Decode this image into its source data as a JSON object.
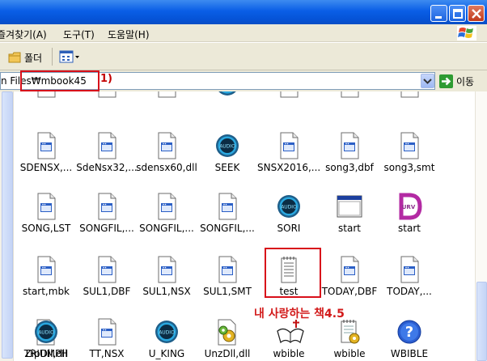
{
  "menu": {
    "items": [
      {
        "label": "즐겨찾기(A)"
      },
      {
        "label": "도구(T)"
      },
      {
        "label": "도움말(H)"
      }
    ]
  },
  "toolbar": {
    "folders_label": "폴더"
  },
  "address": {
    "path": "n Files₩mbook45",
    "go_label": "이동",
    "annotation": "1)"
  },
  "files": [
    {
      "name": "SDENSX,...",
      "icon": "generic-file-icon"
    },
    {
      "name": "SdeNsx32,...",
      "icon": "generic-file-icon"
    },
    {
      "name": "sdensx60,dll",
      "icon": "generic-file-icon"
    },
    {
      "name": "SEEK",
      "icon": "audio-icon"
    },
    {
      "name": "SNSX2016,...",
      "icon": "generic-file-icon"
    },
    {
      "name": "song3,dbf",
      "icon": "generic-file-icon"
    },
    {
      "name": "song3,smt",
      "icon": "generic-file-icon"
    },
    {
      "name": "SONG,LST",
      "icon": "generic-file-icon"
    },
    {
      "name": "SONGFIL,...",
      "icon": "generic-file-icon"
    },
    {
      "name": "SONGFIL,...",
      "icon": "generic-file-icon"
    },
    {
      "name": "SONGFIL,...",
      "icon": "generic-file-icon"
    },
    {
      "name": "SORI",
      "icon": "audio-icon"
    },
    {
      "name": "start",
      "icon": "window-icon"
    },
    {
      "name": "start",
      "icon": "urv-icon"
    },
    {
      "name": "start,mbk",
      "icon": "generic-file-icon"
    },
    {
      "name": "SUL1,DBF",
      "icon": "generic-file-icon"
    },
    {
      "name": "SUL1,NSX",
      "icon": "generic-file-icon"
    },
    {
      "name": "SUL1,SMT",
      "icon": "generic-file-icon"
    },
    {
      "name": "test",
      "icon": "text-file-icon"
    },
    {
      "name": "TODAY,DBF",
      "icon": "generic-file-icon"
    },
    {
      "name": "TODAY,...",
      "icon": "generic-file-icon"
    },
    {
      "name": "TRIUMPH",
      "icon": "audio-icon"
    },
    {
      "name": "TT,NSX",
      "icon": "generic-file-icon"
    },
    {
      "name": "U_KING",
      "icon": "audio-icon"
    },
    {
      "name": "UnzDll,dll",
      "icon": "dll-gear-icon"
    },
    {
      "name": "wbible",
      "icon": "bible-icon"
    },
    {
      "name": "wbible",
      "icon": "notepad-gear-icon"
    },
    {
      "name": "WBIBLE",
      "icon": "help-icon"
    },
    {
      "name": "ZipDll,dll",
      "icon": "dll-gear-icon"
    },
    {
      "name": "",
      "icon": "generic-file-icon"
    },
    {
      "name": "",
      "icon": "generic-file-icon"
    },
    {
      "name": "",
      "icon": "generic-file-icon"
    },
    {
      "name": "",
      "icon": "audio-icon"
    },
    {
      "name": "",
      "icon": "generic-file-icon"
    },
    {
      "name": "",
      "icon": "generic-file-icon"
    },
    {
      "name": "",
      "icon": "generic-file-icon"
    }
  ],
  "annotation_caption": "내 사랑하는 책4.5",
  "colors": {
    "title_bar": "#0553d6",
    "chrome": "#ece9d8",
    "annotation_red": "#d21a1a"
  }
}
